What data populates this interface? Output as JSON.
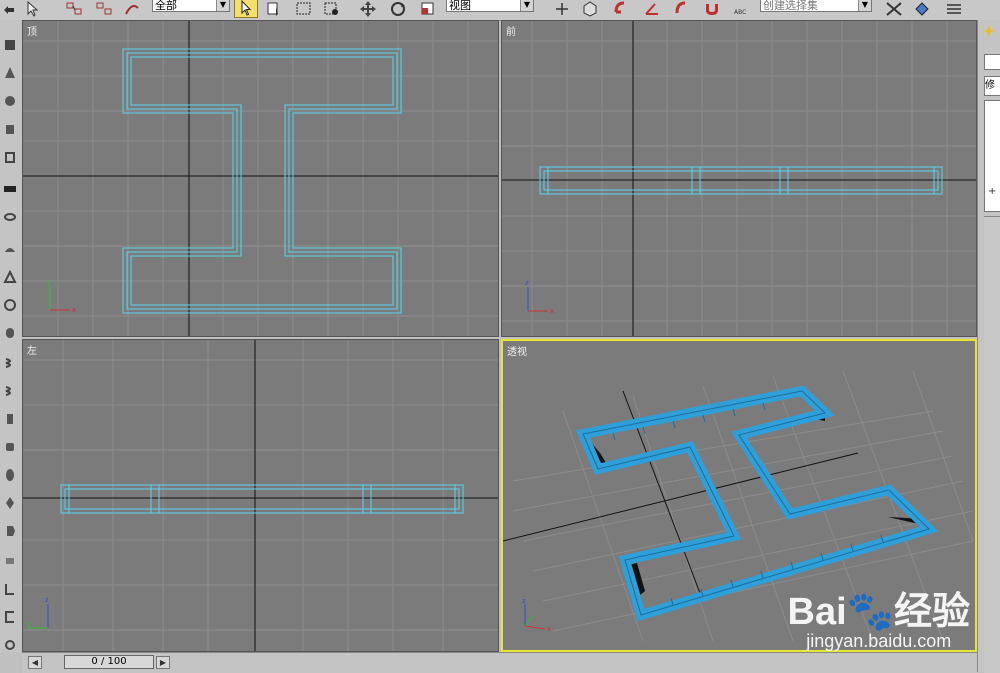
{
  "toolbar": {
    "selection_filter": "全部",
    "ref_coord_system": "视图",
    "named_selection": "创建选择集"
  },
  "viewports": {
    "top": {
      "label": "顶"
    },
    "front": {
      "label": "前"
    },
    "left": {
      "label": "左"
    },
    "perspective": {
      "label": "透视"
    }
  },
  "command_panel": {
    "tab_label": "修"
  },
  "timeline": {
    "frame_display": "0 / 100"
  },
  "watermark": {
    "brand_left": "Bai",
    "brand_right": "经验",
    "url": "jingyan.baidu.com"
  },
  "colors": {
    "viewport_bg": "#7b7b7b",
    "wire": "#5ad4f0",
    "shaded": "#2e9fd8",
    "active_border": "#e6e630"
  },
  "icons": [
    "select-icon",
    "move-icon",
    "rotate-icon",
    "link-icon",
    "unlink-icon",
    "bind-icon",
    "mirror-icon",
    "align-icon",
    "snap-icon",
    "magnet-icon",
    "curve-editor-icon",
    "material-icon"
  ]
}
